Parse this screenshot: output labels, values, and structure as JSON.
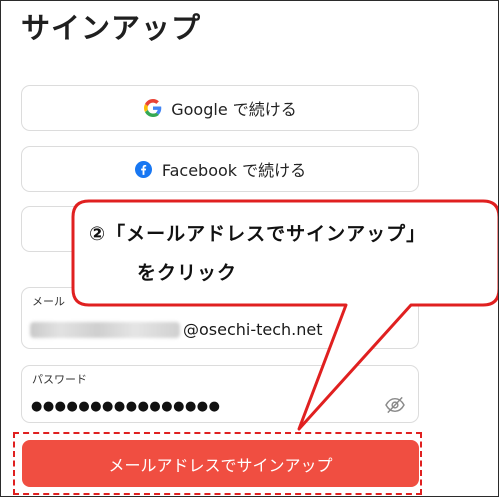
{
  "page": {
    "title": "サインアップ"
  },
  "social": [
    {
      "label": "Google で続ける",
      "icon": "google-icon"
    },
    {
      "label": "Facebook で続ける",
      "icon": "facebook-icon"
    }
  ],
  "email": {
    "label": "メール",
    "value_suffix": "@osechi-tech.net"
  },
  "password": {
    "label": "パスワード",
    "value": "●●●●●●●●●●●●●●●●",
    "toggle_icon": "eye-off-icon"
  },
  "signup_button": {
    "label": "メールアドレスでサインアップ"
  },
  "callout": {
    "line1": "②「メールアドレスでサインアップ」",
    "line2": "をクリック"
  },
  "colors": {
    "accent": "#f04e41",
    "callout_border": "#e02020",
    "facebook": "#1877f2"
  }
}
